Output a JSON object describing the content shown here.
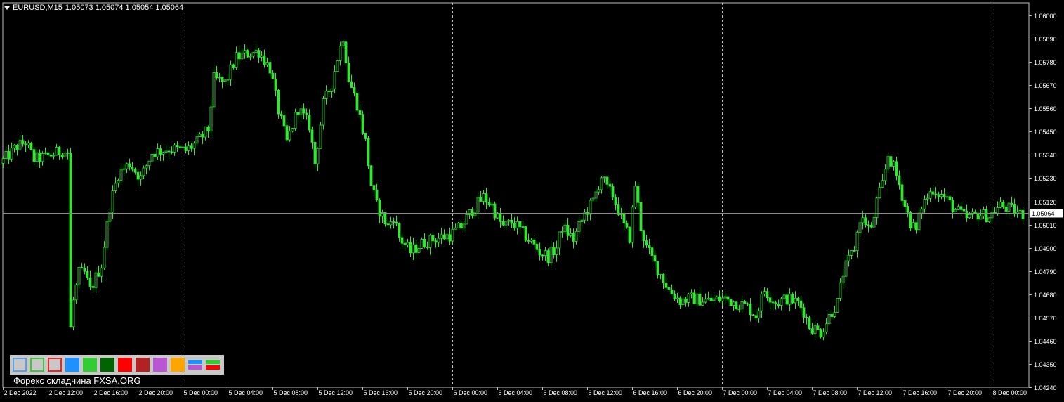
{
  "header": {
    "symbol": "EURUSD,M15",
    "quote": "1.05073 1.05074 1.05054 1.05064"
  },
  "colors": {
    "background": "#000000",
    "candle": "#32e632",
    "grid": "#c0c0c0",
    "axis_text": "#ffffff",
    "current_line": "#8a8a8a"
  },
  "current_price_label": "1.05064",
  "watermark": "Форекс складчина FXSA.ORG",
  "palette": [
    {
      "name": "outline-blue-swatch",
      "style": "outline",
      "color": "#5aa0e6"
    },
    {
      "name": "outline-green-swatch",
      "style": "outline",
      "color": "#3cc83c"
    },
    {
      "name": "outline-red-swatch",
      "style": "outline",
      "color": "#e62828"
    },
    {
      "name": "dodgerblue-swatch",
      "style": "fill",
      "color": "#1e90ff"
    },
    {
      "name": "limegreen-swatch",
      "style": "fill",
      "color": "#32cd32"
    },
    {
      "name": "darkgreen-swatch",
      "style": "fill",
      "color": "#006400"
    },
    {
      "name": "red-swatch",
      "style": "fill",
      "color": "#ff0000"
    },
    {
      "name": "firebrick-swatch",
      "style": "fill",
      "color": "#b22222"
    },
    {
      "name": "orchid-swatch",
      "style": "fill",
      "color": "#ba55d3"
    },
    {
      "name": "orange-swatch",
      "style": "fill",
      "color": "#ffa500"
    },
    {
      "name": "blue-orchid-swatch",
      "style": "double",
      "color": "#1e90ff",
      "color2": "#ba55d3"
    },
    {
      "name": "green-red-swatch",
      "style": "double",
      "color": "#32cd32",
      "color2": "#ff0000"
    }
  ],
  "chart_data": {
    "type": "candlestick",
    "title": "EURUSD,M15",
    "ylim": [
      1.0424,
      1.0606
    ],
    "y_ticks": [
      "1.06000",
      "1.05890",
      "1.05780",
      "1.05670",
      "1.05560",
      "1.05450",
      "1.05340",
      "1.05230",
      "1.05120",
      "1.05010",
      "1.04900",
      "1.04790",
      "1.04680",
      "1.04570",
      "1.04460",
      "1.04350",
      "1.04240"
    ],
    "x_ticks": [
      "2 Dec 2022",
      "2 Dec 12:00",
      "2 Dec 16:00",
      "2 Dec 20:00",
      "5 Dec 00:00",
      "5 Dec 04:00",
      "5 Dec 08:00",
      "5 Dec 12:00",
      "5 Dec 16:00",
      "5 Dec 20:00",
      "6 Dec 00:00",
      "6 Dec 04:00",
      "6 Dec 08:00",
      "6 Dec 12:00",
      "6 Dec 16:00",
      "6 Dec 20:00",
      "7 Dec 00:00",
      "7 Dec 04:00",
      "7 Dec 08:00",
      "7 Dec 12:00",
      "7 Dec 16:00",
      "7 Dec 20:00",
      "8 Dec 00:00"
    ],
    "day_separators": [
      "5 Dec 00:00",
      "6 Dec 00:00",
      "7 Dec 00:00",
      "8 Dec 00:00"
    ],
    "current_price": 1.05064,
    "series": [
      {
        "anchors": [
          [
            "2 Dec 08:00",
            1.053
          ],
          [
            "2 Dec 09:30",
            1.0538
          ],
          [
            "2 Dec 10:15",
            1.054
          ],
          [
            "2 Dec 11:00",
            1.0532
          ],
          [
            "2 Dec 12:00",
            1.0533
          ],
          [
            "2 Dec 13:30",
            1.0536
          ],
          [
            "2 Dec 14:00",
            1.0535
          ],
          [
            "2 Dec 14:15",
            1.0452
          ],
          [
            "2 Dec 14:30",
            1.0465
          ],
          [
            "2 Dec 15:00",
            1.0478
          ],
          [
            "2 Dec 15:30",
            1.0478
          ],
          [
            "2 Dec 16:00",
            1.047
          ],
          [
            "2 Dec 17:00",
            1.0482
          ],
          [
            "2 Dec 17:45",
            1.051
          ],
          [
            "2 Dec 18:30",
            1.0525
          ],
          [
            "2 Dec 19:30",
            1.053
          ],
          [
            "2 Dec 20:30",
            1.0523
          ],
          [
            "2 Dec 21:30",
            1.0535
          ],
          [
            "2 Dec 23:00",
            1.0537
          ],
          [
            "5 Dec 00:30",
            1.0536
          ],
          [
            "5 Dec 01:30",
            1.054
          ],
          [
            "5 Dec 02:30",
            1.0546
          ],
          [
            "5 Dec 03:00",
            1.057
          ],
          [
            "5 Dec 04:00",
            1.0568
          ],
          [
            "5 Dec 05:00",
            1.058
          ],
          [
            "5 Dec 06:00",
            1.0582
          ],
          [
            "5 Dec 07:00",
            1.0583
          ],
          [
            "5 Dec 08:00",
            1.0575
          ],
          [
            "5 Dec 08:45",
            1.0555
          ],
          [
            "5 Dec 09:30",
            1.054
          ],
          [
            "5 Dec 10:30",
            1.0556
          ],
          [
            "5 Dec 11:30",
            1.0548
          ],
          [
            "5 Dec 12:00",
            1.053
          ],
          [
            "5 Dec 12:45",
            1.0558
          ],
          [
            "5 Dec 13:30",
            1.0568
          ],
          [
            "5 Dec 14:00",
            1.058
          ],
          [
            "5 Dec 14:30",
            1.059
          ],
          [
            "5 Dec 15:00",
            1.057
          ],
          [
            "5 Dec 15:45",
            1.0558
          ],
          [
            "5 Dec 16:30",
            1.054
          ],
          [
            "5 Dec 17:00",
            1.052
          ],
          [
            "5 Dec 17:30",
            1.051
          ],
          [
            "5 Dec 18:00",
            1.0505
          ],
          [
            "5 Dec 18:30",
            1.05
          ],
          [
            "5 Dec 19:00",
            1.0505
          ],
          [
            "5 Dec 19:30",
            1.0495
          ],
          [
            "5 Dec 20:30",
            1.0488
          ],
          [
            "5 Dec 21:30",
            1.0492
          ],
          [
            "5 Dec 22:30",
            1.0494
          ],
          [
            "6 Dec 00:00",
            1.0496
          ],
          [
            "6 Dec 01:00",
            1.05
          ],
          [
            "6 Dec 02:00",
            1.0508
          ],
          [
            "6 Dec 03:00",
            1.0514
          ],
          [
            "6 Dec 03:45",
            1.051
          ],
          [
            "6 Dec 04:15",
            1.0504
          ],
          [
            "6 Dec 04:45",
            1.05
          ],
          [
            "6 Dec 05:30",
            1.0502
          ],
          [
            "6 Dec 06:00",
            1.05
          ],
          [
            "6 Dec 07:00",
            1.0494
          ],
          [
            "6 Dec 08:00",
            1.0488
          ],
          [
            "6 Dec 08:45",
            1.0486
          ],
          [
            "6 Dec 09:30",
            1.049
          ],
          [
            "6 Dec 10:00",
            1.05
          ],
          [
            "6 Dec 11:00",
            1.0494
          ],
          [
            "6 Dec 12:00",
            1.0506
          ],
          [
            "6 Dec 12:45",
            1.0512
          ],
          [
            "6 Dec 13:30",
            1.0524
          ],
          [
            "6 Dec 14:00",
            1.0518
          ],
          [
            "6 Dec 14:30",
            1.0515
          ],
          [
            "6 Dec 15:00",
            1.0508
          ],
          [
            "6 Dec 15:30",
            1.05
          ],
          [
            "6 Dec 16:00",
            1.0495
          ],
          [
            "6 Dec 16:30",
            1.052
          ],
          [
            "6 Dec 17:00",
            1.05
          ],
          [
            "6 Dec 17:30",
            1.049
          ],
          [
            "6 Dec 18:30",
            1.048
          ],
          [
            "6 Dec 19:30",
            1.047
          ],
          [
            "6 Dec 20:30",
            1.0465
          ],
          [
            "6 Dec 21:30",
            1.0466
          ],
          [
            "6 Dec 23:00",
            1.0465
          ],
          [
            "7 Dec 00:30",
            1.0466
          ],
          [
            "7 Dec 01:30",
            1.0464
          ],
          [
            "7 Dec 02:30",
            1.0462
          ],
          [
            "7 Dec 03:15",
            1.0458
          ],
          [
            "7 Dec 04:00",
            1.047
          ],
          [
            "7 Dec 05:00",
            1.0464
          ],
          [
            "7 Dec 06:00",
            1.0466
          ],
          [
            "7 Dec 07:00",
            1.0464
          ],
          [
            "7 Dec 07:30",
            1.046
          ],
          [
            "7 Dec 08:00",
            1.0453
          ],
          [
            "7 Dec 09:00",
            1.045
          ],
          [
            "7 Dec 10:00",
            1.046
          ],
          [
            "7 Dec 10:30",
            1.0464
          ],
          [
            "7 Dec 11:00",
            1.0478
          ],
          [
            "7 Dec 12:00",
            1.049
          ],
          [
            "7 Dec 12:30",
            1.0504
          ],
          [
            "7 Dec 13:00",
            1.0502
          ],
          [
            "7 Dec 13:30",
            1.0498
          ],
          [
            "7 Dec 14:00",
            1.0512
          ],
          [
            "7 Dec 14:30",
            1.052
          ],
          [
            "7 Dec 15:00",
            1.0534
          ],
          [
            "7 Dec 15:30",
            1.0528
          ],
          [
            "7 Dec 16:00",
            1.052
          ],
          [
            "7 Dec 16:30",
            1.051
          ],
          [
            "7 Dec 17:00",
            1.0502
          ],
          [
            "7 Dec 17:30",
            1.0498
          ],
          [
            "7 Dec 18:00",
            1.051
          ],
          [
            "7 Dec 19:00",
            1.0518
          ],
          [
            "7 Dec 20:00",
            1.0514
          ],
          [
            "7 Dec 21:00",
            1.0508
          ],
          [
            "7 Dec 22:00",
            1.0504
          ],
          [
            "7 Dec 23:00",
            1.0506
          ],
          [
            "8 Dec 00:00",
            1.0505
          ],
          [
            "8 Dec 01:00",
            1.051
          ],
          [
            "8 Dec 02:00",
            1.0508
          ],
          [
            "8 Dec 02:45",
            1.0506
          ]
        ]
      }
    ]
  }
}
